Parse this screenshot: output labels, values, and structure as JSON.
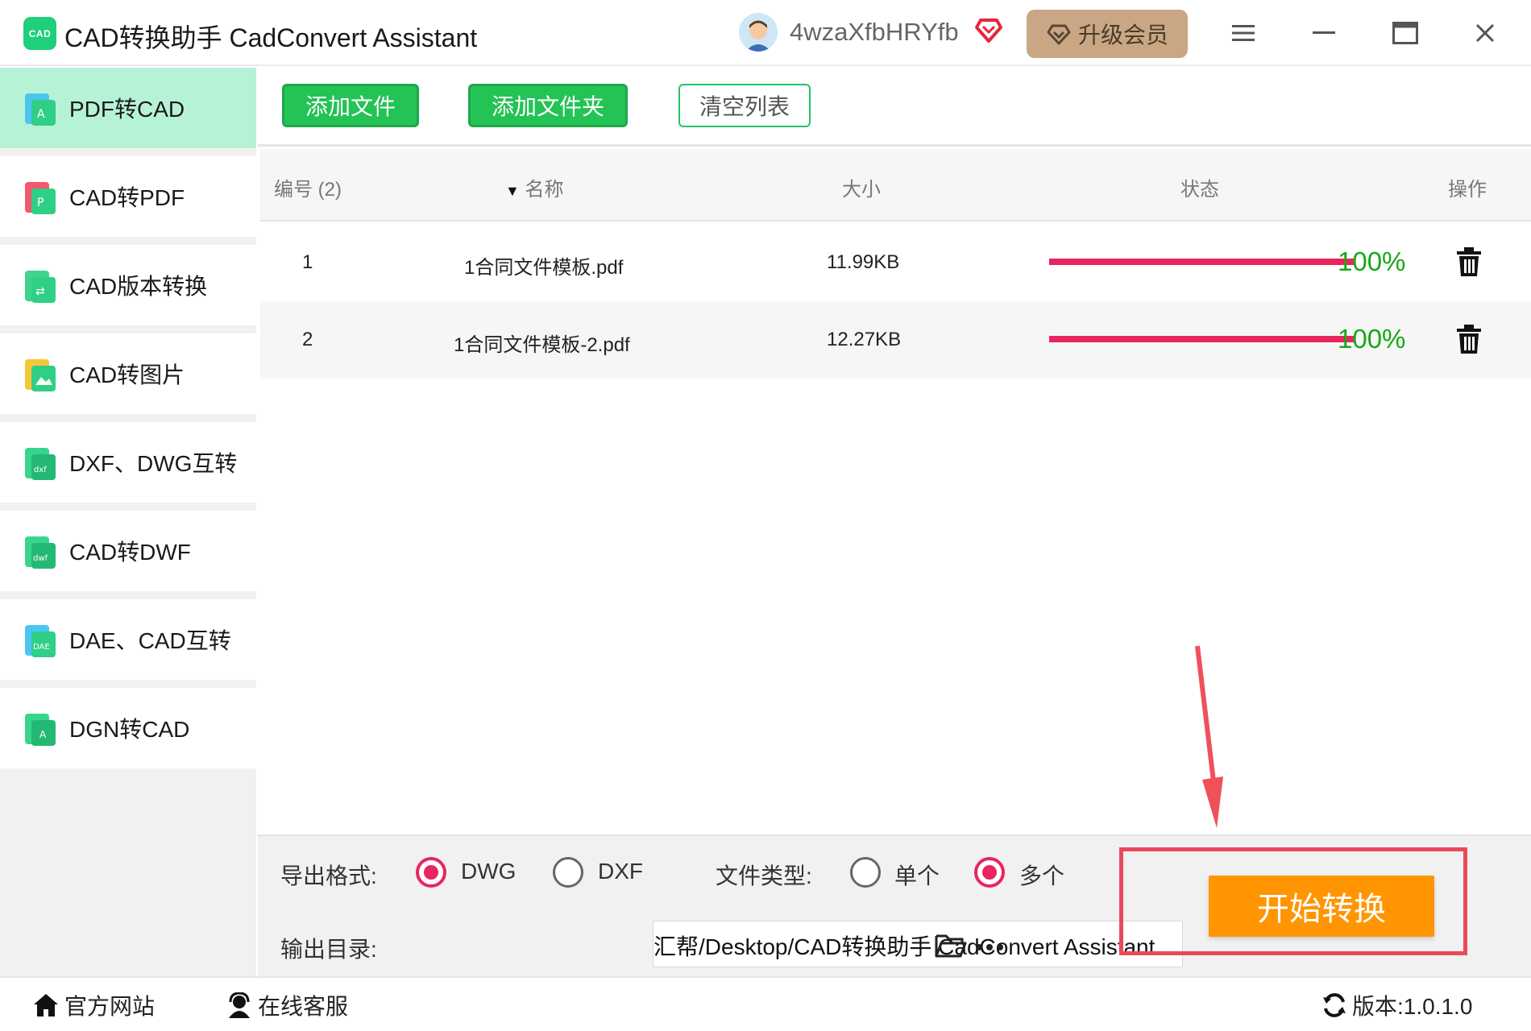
{
  "app": {
    "logo_text": "CAD",
    "title": "CAD转换助手 CadConvert Assistant",
    "username": "4wzaXfbHRYfb",
    "upgrade_label": "升级会员",
    "accent_color": "#24c355",
    "progress_color": "#e8255f",
    "start_color": "#ff9500"
  },
  "sidebar": {
    "items": [
      {
        "label": "PDF转CAD",
        "icon": "pdf-to-cad-icon",
        "active": true
      },
      {
        "label": "CAD转PDF",
        "icon": "cad-to-pdf-icon"
      },
      {
        "label": "CAD版本转换",
        "icon": "cad-version-icon"
      },
      {
        "label": "CAD转图片",
        "icon": "cad-to-image-icon"
      },
      {
        "label": "DXF、DWG互转",
        "icon": "dxf-dwg-icon"
      },
      {
        "label": "CAD转DWF",
        "icon": "cad-to-dwf-icon"
      },
      {
        "label": "DAE、CAD互转",
        "icon": "dae-cad-icon"
      },
      {
        "label": "DGN转CAD",
        "icon": "dgn-to-cad-icon"
      }
    ]
  },
  "toolbar": {
    "add_file": "添加文件",
    "add_folder": "添加文件夹",
    "clear_list": "清空列表"
  },
  "table": {
    "headers": {
      "index": "编号 (2)",
      "name": "名称",
      "size": "大小",
      "status": "状态",
      "action": "操作"
    },
    "rows": [
      {
        "index": "1",
        "name": "1合同文件模板.pdf",
        "size": "11.99KB",
        "progress": 100,
        "percent": "100%"
      },
      {
        "index": "2",
        "name": "1合同文件模板-2.pdf",
        "size": "12.27KB",
        "progress": 100,
        "percent": "100%"
      }
    ]
  },
  "options": {
    "format_label": "导出格式:",
    "format_dwg": "DWG",
    "format_dxf": "DXF",
    "format_selected": "DWG",
    "filetype_label": "文件类型:",
    "filetype_single": "单个",
    "filetype_multi": "多个",
    "filetype_selected": "多个",
    "output_label": "输出目录:",
    "output_path": "汇帮/Desktop/CAD转换助手 CadConvert Assistant",
    "start_label": "开始转换"
  },
  "footer": {
    "website": "官方网站",
    "support": "在线客服",
    "version": "版本:1.0.1.0"
  }
}
